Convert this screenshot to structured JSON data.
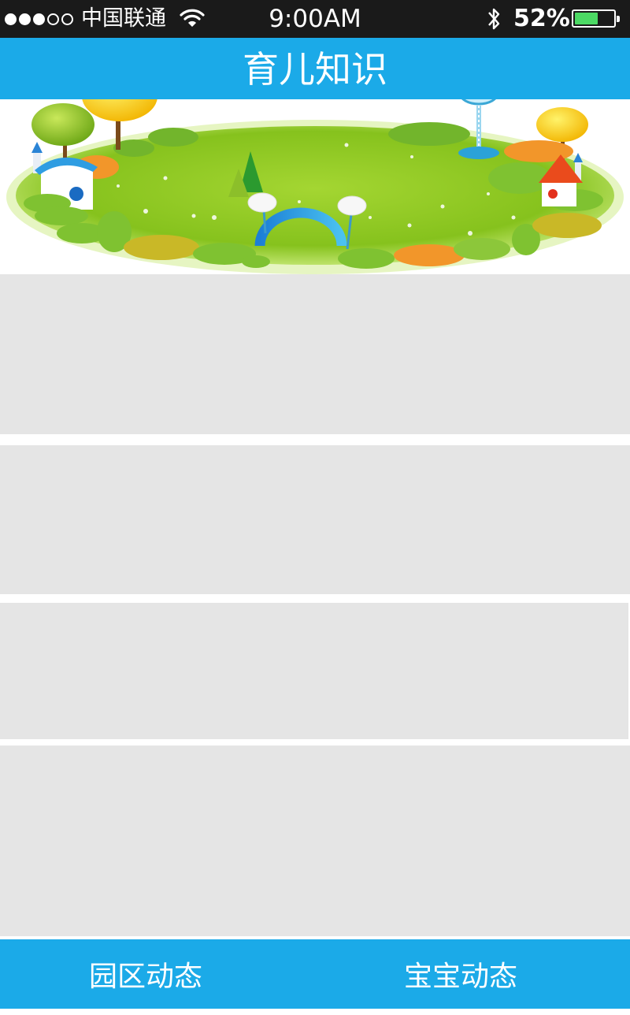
{
  "status_bar": {
    "carrier": "中国联通",
    "time": "9:00AM",
    "battery_percent": "52%",
    "battery_level": 0.6,
    "signal_bars_filled": 3,
    "signal_bars_total": 5,
    "icons": [
      "signal-icon",
      "wifi-icon",
      "bluetooth-icon",
      "battery-icon"
    ]
  },
  "nav": {
    "title": "育儿知识"
  },
  "banner": {
    "image": "cartoon-park-illustration"
  },
  "content": {
    "cards": 4
  },
  "tabbar": {
    "tabs": [
      {
        "label": "园区动态"
      },
      {
        "label": "宝宝动态"
      }
    ]
  },
  "colors": {
    "status_bg": "#1a1a1a",
    "accent": "#1baae8",
    "card_bg": "#e5e5e5",
    "battery_fill": "#4cd964"
  }
}
